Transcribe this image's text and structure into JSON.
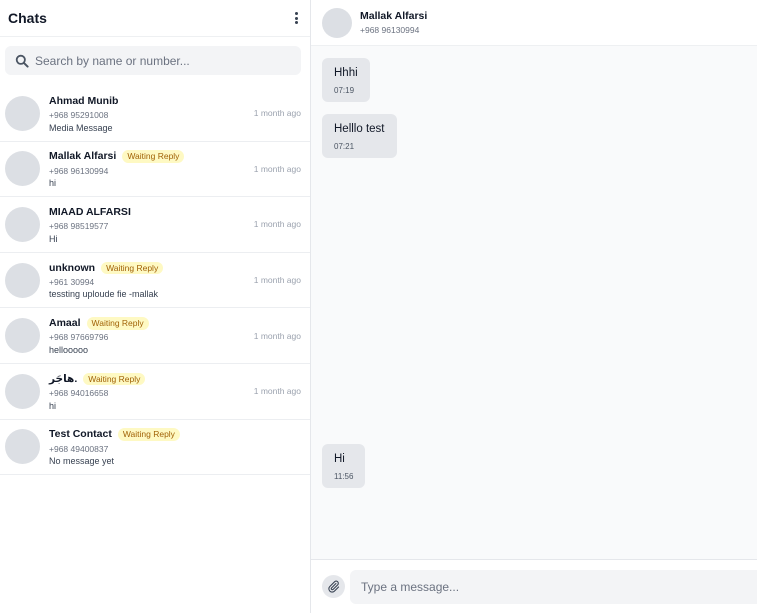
{
  "sidebar": {
    "title": "Chats",
    "menu_icon": "vertical-dots-icon",
    "search": {
      "placeholder": "Search by name or number...",
      "value": "",
      "icon": "search-icon"
    },
    "chats": [
      {
        "name": "Ahmad Munib",
        "badge": "",
        "phone": "+968 95291008",
        "last_message": "Media Message",
        "time": "1 month ago"
      },
      {
        "name": "Mallak Alfarsi",
        "badge": "Waiting Reply",
        "phone": "+968 96130994",
        "last_message": "hi",
        "time": "1 month ago"
      },
      {
        "name": "MIAAD ALFARSI",
        "badge": "",
        "phone": "+968 98519577",
        "last_message": "Hi",
        "time": "1 month ago"
      },
      {
        "name": "unknown",
        "badge": "Waiting Reply",
        "phone": "+961 30994",
        "last_message": "tessting uploude fie -mallak",
        "time": "1 month ago"
      },
      {
        "name": "Amaal",
        "badge": "Waiting Reply",
        "phone": "+968 97669796",
        "last_message": "hellooooo",
        "time": "1 month ago"
      },
      {
        "name": "هاجَر.",
        "badge": "Waiting Reply",
        "phone": "+968 94016658",
        "last_message": "hi",
        "time": "1 month ago"
      },
      {
        "name": "Test Contact",
        "badge": "Waiting Reply",
        "phone": "+968 49400837",
        "last_message": "No message yet",
        "time": ""
      }
    ]
  },
  "conversation": {
    "contact_name": "Mallak Alfarsi",
    "contact_phone": "+968 96130994",
    "messages": [
      {
        "text": "Hhhi",
        "time": "07:19"
      },
      {
        "text": "Helllo test",
        "time": "07:21"
      },
      {
        "text": "Hi",
        "time": "11:56"
      }
    ],
    "composer": {
      "placeholder": "Type a message...",
      "value": "",
      "attach_icon": "paperclip-icon"
    }
  },
  "colors": {
    "badge_bg": "#fef9c3",
    "badge_text": "#a16207",
    "bubble_bg": "#e5e7eb",
    "avatar_bg": "#dcdfe4"
  }
}
